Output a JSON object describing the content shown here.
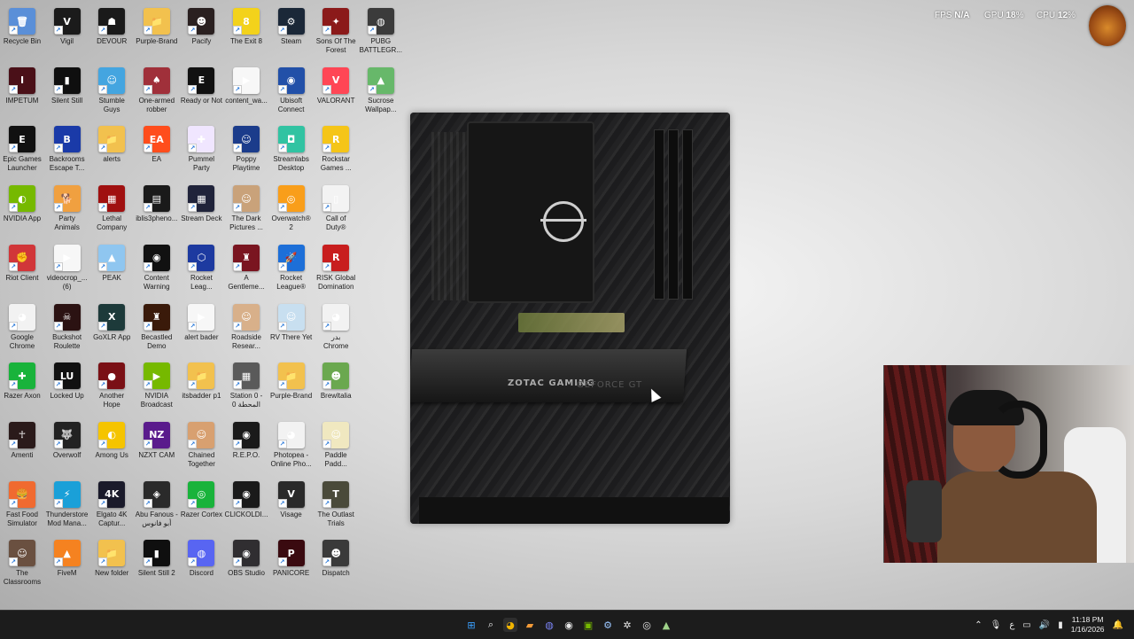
{
  "hud": {
    "fps_label": "FPS",
    "fps_value": "N/A",
    "gpu_label": "GPU",
    "gpu_value": "18",
    "cpu_label": "CPU",
    "cpu_value": "12",
    "percent": "%"
  },
  "desktop_icons": [
    {
      "label": "Recycle Bin",
      "label2": "",
      "color": "#5a8fd8",
      "glyph": "🗑"
    },
    {
      "label": "Vigil",
      "label2": "",
      "color": "#1b1b1b",
      "glyph": "V"
    },
    {
      "label": "DEVOUR",
      "label2": "",
      "color": "#1a1a1a",
      "glyph": "☗"
    },
    {
      "label": "Purple-Brand",
      "label2": "",
      "color": "#f2c14e",
      "glyph": "📁"
    },
    {
      "label": "Pacify",
      "label2": "",
      "color": "#2a2020",
      "glyph": "☻"
    },
    {
      "label": "The Exit 8",
      "label2": "",
      "color": "#f3d21b",
      "glyph": "8"
    },
    {
      "label": "Steam",
      "label2": "",
      "color": "#1b2838",
      "glyph": "⚙"
    },
    {
      "label": "Sons Of The",
      "label2": "Forest",
      "color": "#8b1a1a",
      "glyph": "✦"
    },
    {
      "label": "PUBG",
      "label2": "BATTLEGR...",
      "color": "#3b3b3b",
      "glyph": "◍"
    },
    {
      "label": "IMPETUM",
      "label2": "",
      "color": "#4a1018",
      "glyph": "I"
    },
    {
      "label": "Silent Still",
      "label2": "",
      "color": "#0f0f0f",
      "glyph": "▮"
    },
    {
      "label": "Stumble",
      "label2": "Guys",
      "color": "#44a5e0",
      "glyph": "☺"
    },
    {
      "label": "One-armed",
      "label2": "robber",
      "color": "#a0303a",
      "glyph": "♠"
    },
    {
      "label": "Ready or Not",
      "label2": "",
      "color": "#111111",
      "glyph": "E"
    },
    {
      "label": "content_wa...",
      "label2": "",
      "color": "#f7f7f7",
      "glyph": "▶"
    },
    {
      "label": "Ubisoft",
      "label2": "Connect",
      "color": "#2250a8",
      "glyph": "◉"
    },
    {
      "label": "VALORANT",
      "label2": "",
      "color": "#ff4655",
      "glyph": "V"
    },
    {
      "label": "Sucrose",
      "label2": "Wallpap...",
      "color": "#67b86a",
      "glyph": "▲"
    },
    {
      "label": "Epic Games",
      "label2": "Launcher",
      "color": "#111111",
      "glyph": "E"
    },
    {
      "label": "Backrooms",
      "label2": "Escape T...",
      "color": "#1a3aa8",
      "glyph": "B"
    },
    {
      "label": "alerts",
      "label2": "",
      "color": "#f2c14e",
      "glyph": "📁"
    },
    {
      "label": "EA",
      "label2": "",
      "color": "#ff4d1c",
      "glyph": "EA"
    },
    {
      "label": "Pummel",
      "label2": "Party",
      "color": "#f0e6ff",
      "glyph": "✚"
    },
    {
      "label": "Poppy",
      "label2": "Playtime",
      "color": "#1b3c8b",
      "glyph": "☺"
    },
    {
      "label": "Streamlabs",
      "label2": "Desktop",
      "color": "#31c3a2",
      "glyph": "◘"
    },
    {
      "label": "Rockstar",
      "label2": "Games ...",
      "color": "#f5c518",
      "glyph": "R"
    },
    {
      "label": "NVIDIA App",
      "label2": "",
      "color": "#76b900",
      "glyph": "◐"
    },
    {
      "label": "Party",
      "label2": "Animals",
      "color": "#f0a040",
      "glyph": "🐕"
    },
    {
      "label": "Lethal",
      "label2": "Company",
      "color": "#a01010",
      "glyph": "▦"
    },
    {
      "label": "iblis3pheno...",
      "label2": "",
      "color": "#1a1a1a",
      "glyph": "▤"
    },
    {
      "label": "Stream Deck",
      "label2": "",
      "color": "#20233a",
      "glyph": "▦"
    },
    {
      "label": "The Dark",
      "label2": "Pictures ...",
      "color": "#c9a27a",
      "glyph": "☺"
    },
    {
      "label": "Overwatch®",
      "label2": "2",
      "color": "#f99e1a",
      "glyph": "◎"
    },
    {
      "label": "Call of",
      "label2": "Duty®",
      "color": "#f3f3f3",
      "glyph": "▯"
    },
    {
      "label": "Riot Client",
      "label2": "",
      "color": "#d13639",
      "glyph": "✊"
    },
    {
      "label": "videocrop_...",
      "label2": "(6)",
      "color": "#f7f7f7",
      "glyph": "▶"
    },
    {
      "label": "PEAK",
      "label2": "",
      "color": "#8fc6f0",
      "glyph": "▲"
    },
    {
      "label": "Content",
      "label2": "Warning",
      "color": "#111111",
      "glyph": "◉"
    },
    {
      "label": "Rocket",
      "label2": "Leag...",
      "color": "#1d3aa0",
      "glyph": "⬡"
    },
    {
      "label": "A",
      "label2": "Gentleme...",
      "color": "#7a1520",
      "glyph": "♜"
    },
    {
      "label": "Rocket",
      "label2": "League®",
      "color": "#1d6fd8",
      "glyph": "🚀"
    },
    {
      "label": "RISK Global",
      "label2": "Domination",
      "color": "#c81e1e",
      "glyph": "R"
    },
    {
      "label": "Google",
      "label2": "Chrome",
      "color": "#f2f2f2",
      "glyph": "◕"
    },
    {
      "label": "Buckshot",
      "label2": "Roulette",
      "color": "#2b1212",
      "glyph": "☠"
    },
    {
      "label": "GoXLR App",
      "label2": "",
      "color": "#1d3a3a",
      "glyph": "X"
    },
    {
      "label": "Becastled",
      "label2": "Demo",
      "color": "#3a1a0a",
      "glyph": "♜"
    },
    {
      "label": "alert bader",
      "label2": "",
      "color": "#f7f7f7",
      "glyph": "▶"
    },
    {
      "label": "Roadside",
      "label2": "Resear...",
      "color": "#d8b08a",
      "glyph": "☺"
    },
    {
      "label": "RV There Yet",
      "label2": "",
      "color": "#c8dff0",
      "glyph": "☺"
    },
    {
      "label": "بدر",
      "label2": "Chrome",
      "color": "#f2f2f2",
      "glyph": "◕"
    },
    {
      "label": "Razer Axon",
      "label2": "",
      "color": "#19b33b",
      "glyph": "✚"
    },
    {
      "label": "Locked Up",
      "label2": "",
      "color": "#111111",
      "glyph": "LU"
    },
    {
      "label": "Another",
      "label2": "Hope",
      "color": "#7a1015",
      "glyph": "●"
    },
    {
      "label": "NVIDIA",
      "label2": "Broadcast",
      "color": "#76b900",
      "glyph": "▶"
    },
    {
      "label": "itsbadder p1",
      "label2": "",
      "color": "#f2c14e",
      "glyph": "📁"
    },
    {
      "label": "Station 0 -",
      "label2": "المحطة 0",
      "color": "#5a5a5a",
      "glyph": "▦"
    },
    {
      "label": "Purple-Brand",
      "label2": "",
      "color": "#f2c14e",
      "glyph": "📁"
    },
    {
      "label": "Brewltalia",
      "label2": "",
      "color": "#6aa84f",
      "glyph": "☻"
    },
    {
      "label": "Amenti",
      "label2": "",
      "color": "#2a1a1a",
      "glyph": "☥"
    },
    {
      "label": "Overwolf",
      "label2": "",
      "color": "#222222",
      "glyph": "🐺"
    },
    {
      "label": "Among Us",
      "label2": "",
      "color": "#f5c400",
      "glyph": "◐"
    },
    {
      "label": "NZXT CAM",
      "label2": "",
      "color": "#5a1b8c",
      "glyph": "NZ"
    },
    {
      "label": "Chained",
      "label2": "Together",
      "color": "#d8a070",
      "glyph": "☺"
    },
    {
      "label": "R.E.P.O.",
      "label2": "",
      "color": "#1a1a1a",
      "glyph": "◉"
    },
    {
      "label": "Photopea -",
      "label2": "Online Pho...",
      "color": "#f2f2f2",
      "glyph": "◕"
    },
    {
      "label": "Paddle",
      "label2": "Padd...",
      "color": "#f0e8c0",
      "glyph": "☺"
    },
    {
      "label": "Fast Food",
      "label2": "Simulator",
      "color": "#f06a30",
      "glyph": "🍔"
    },
    {
      "label": "Thunderstore",
      "label2": "Mod Mana...",
      "color": "#1aa0d8",
      "glyph": "⚡"
    },
    {
      "label": "Elgato 4K",
      "label2": "Captur...",
      "color": "#1a1a2a",
      "glyph": "4K"
    },
    {
      "label": "Abu Fanous -",
      "label2": "أبو فانوس",
      "color": "#2a2a2a",
      "glyph": "◈"
    },
    {
      "label": "Razer Cortex",
      "label2": "",
      "color": "#19b33b",
      "glyph": "◎"
    },
    {
      "label": "CLICKOLDI...",
      "label2": "",
      "color": "#1a1a1a",
      "glyph": "◉"
    },
    {
      "label": "Visage",
      "label2": "",
      "color": "#2a2a2a",
      "glyph": "V"
    },
    {
      "label": "The Outlast",
      "label2": "Trials",
      "color": "#4a4a3a",
      "glyph": "T"
    },
    {
      "label": "The",
      "label2": "Classrooms",
      "color": "#6a5040",
      "glyph": "☺"
    },
    {
      "label": "FiveM",
      "label2": "",
      "color": "#f58220",
      "glyph": "▲"
    },
    {
      "label": "New folder",
      "label2": "",
      "color": "#f2c14e",
      "glyph": "📁"
    },
    {
      "label": "Silent Still 2",
      "label2": "",
      "color": "#0f0f0f",
      "glyph": "▮"
    },
    {
      "label": "Discord",
      "label2": "",
      "color": "#5865f2",
      "glyph": "◍"
    },
    {
      "label": "OBS Studio",
      "label2": "",
      "color": "#302e31",
      "glyph": "◉"
    },
    {
      "label": "PANICORE",
      "label2": "",
      "color": "#3a0a10",
      "glyph": "P"
    },
    {
      "label": "Dispatch",
      "label2": "",
      "color": "#3a3a3a",
      "glyph": "☻"
    }
  ],
  "board": {
    "brand_text": "ZOTAC GAMING",
    "gpu_text": "GEFORCE GT"
  },
  "taskbar": {
    "center_icons": [
      "windows-start",
      "search",
      "chrome",
      "discord",
      "file-manager",
      "obs",
      "nvidia",
      "steam",
      "settings",
      "game",
      "app"
    ],
    "time": "11:18 PM",
    "date": "1/16/2026",
    "lang": "ع"
  }
}
